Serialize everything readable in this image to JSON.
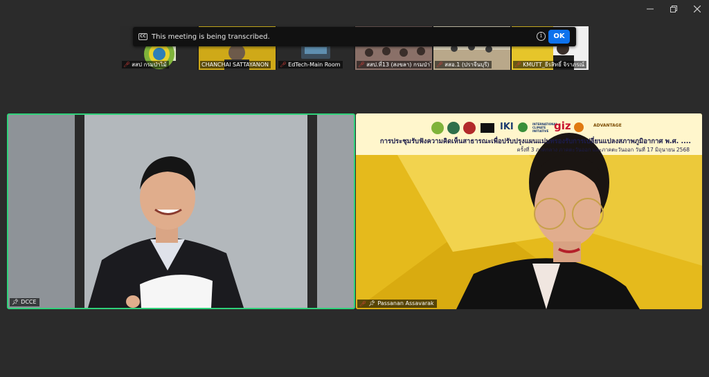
{
  "window_controls": {
    "minimize_icon": "minimize-icon",
    "restore_icon": "restore-icon",
    "close_icon": "close-icon"
  },
  "banner": {
    "cc_label": "CC",
    "message": "This meeting is being transcribed.",
    "info_icon": "info-icon",
    "ok_label": "OK"
  },
  "filmstrip": [
    {
      "name": "สสป กรมป่าไม้",
      "muted": true
    },
    {
      "name": "CHANCHAI SATTAYANON",
      "muted": false
    },
    {
      "name": "EdTech-Main Room",
      "muted": true
    },
    {
      "name": "สสป.ที่13 (สงขลา) กรมป่าไม้",
      "muted": true
    },
    {
      "name": "สสอ.1 (ปราจีนบุรี)",
      "muted": true
    },
    {
      "name": "KMUTT_ธีรสิทธิ์ จิราภรณ์",
      "muted": true
    }
  ],
  "main_tiles": {
    "left": {
      "name": "DCCE",
      "pinned": true,
      "muted": false,
      "active_speaker": true
    },
    "right": {
      "name": "Passanan Assavarak",
      "pinned": true,
      "muted": true
    }
  },
  "slide": {
    "title": "การประชุมรับฟังความคิดเห็นสาธารณะเพื่อปรับปรุงแผนแม่บทรองรับการเปลี่ยนแปลงสภาพภูมิอากาศ พ.ศ. ....",
    "subtitle": "ครั้งที่ 3 ภาคกลาง ภาคตะวันออก และภาคตะวันออก วันที่ 17 มิถุนายน 2568",
    "logo_iki": "IKI",
    "logo_intl": "INTERNATIONAL CLIMATE INITIATIVE",
    "logo_giz": "giz",
    "logo_adv": "ADVANTAGE"
  },
  "colors": {
    "background": "#2b2b2b",
    "active_speaker_border": "#2fd27a",
    "ok_button": "#0e72ed",
    "muted_icon": "#e0413c",
    "slide_yellow": "#e4b919"
  }
}
